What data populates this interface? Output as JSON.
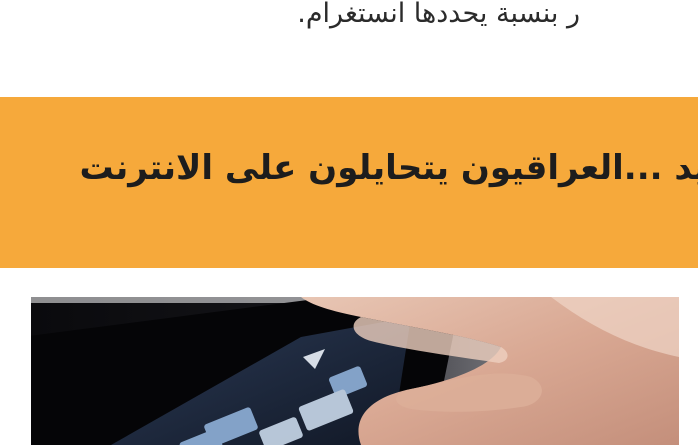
{
  "article": {
    "intro_fragment": "ر بنسبة يحددها انستغرام.",
    "headline": "ع جديد ...العراقيون يتحايلون على الانترنت"
  },
  "colors": {
    "banner": "#f6a93b",
    "headline_text": "#1d1d1d",
    "body_text": "#2b2b2b",
    "background": "#ffffff"
  },
  "photo": {
    "subject": "hand typing on smartphone keyboard"
  }
}
